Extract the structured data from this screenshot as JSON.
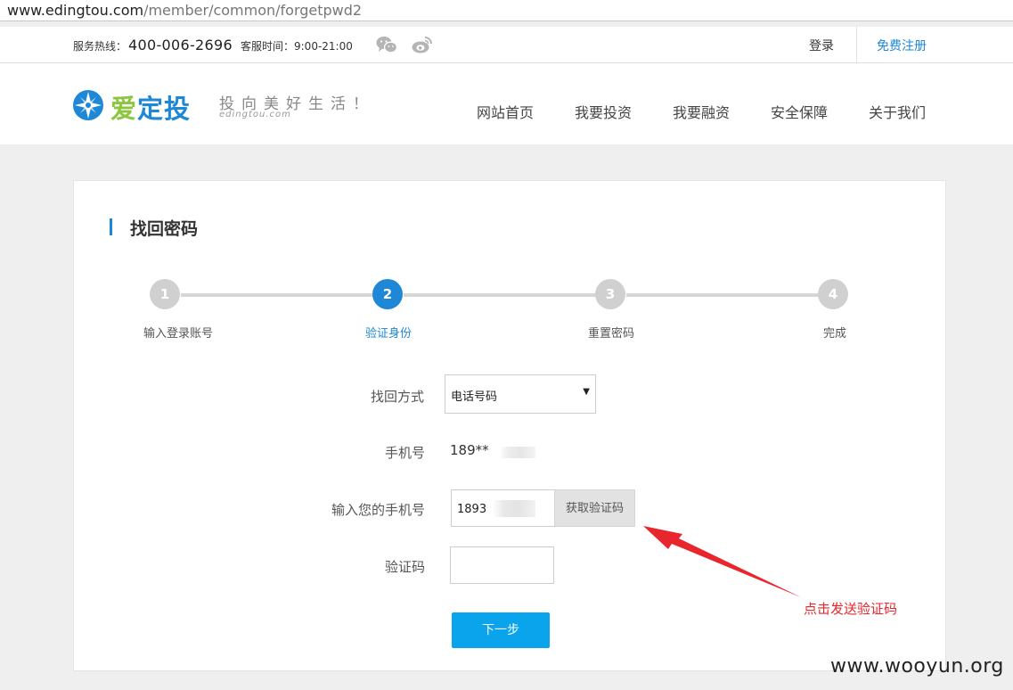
{
  "browser": {
    "url_host": "www.edingtou.com",
    "url_path": "/member/common/forgetpwd2"
  },
  "topbar": {
    "hotline_label": "服务热线：",
    "hotline_number": "400-006-2696",
    "hours": "客服时间：9:00-21:00",
    "login": "登录",
    "register": "免费注册"
  },
  "header": {
    "logo_green": "爱",
    "logo_blue": "定投",
    "slogan": "投向美好生活！",
    "domain": "edingtou.com",
    "nav": [
      "网站首页",
      "我要投资",
      "我要融资",
      "安全保障",
      "关于我们"
    ]
  },
  "page": {
    "title": "找回密码",
    "steps": [
      {
        "num": "1",
        "label": "输入登录账号",
        "active": false
      },
      {
        "num": "2",
        "label": "验证身份",
        "active": true
      },
      {
        "num": "3",
        "label": "重置密码",
        "active": false
      },
      {
        "num": "4",
        "label": "完成",
        "active": false
      }
    ],
    "form": {
      "method_label": "找回方式",
      "method_value": "电话号码",
      "phone_label": "手机号",
      "phone_value": "189**",
      "input_phone_label": "输入您的手机号",
      "input_phone_value": "1893",
      "get_code_button": "获取验证码",
      "code_label": "验证码",
      "code_value": "",
      "next_button": "下一步"
    }
  },
  "annotation": {
    "text": "点击发送验证码",
    "color": "#e8262d"
  },
  "watermark": "www.wooyun.org",
  "colors": {
    "accent": "#1e88d6",
    "button": "#0aa4ec",
    "logo_green": "#8cc63f"
  }
}
